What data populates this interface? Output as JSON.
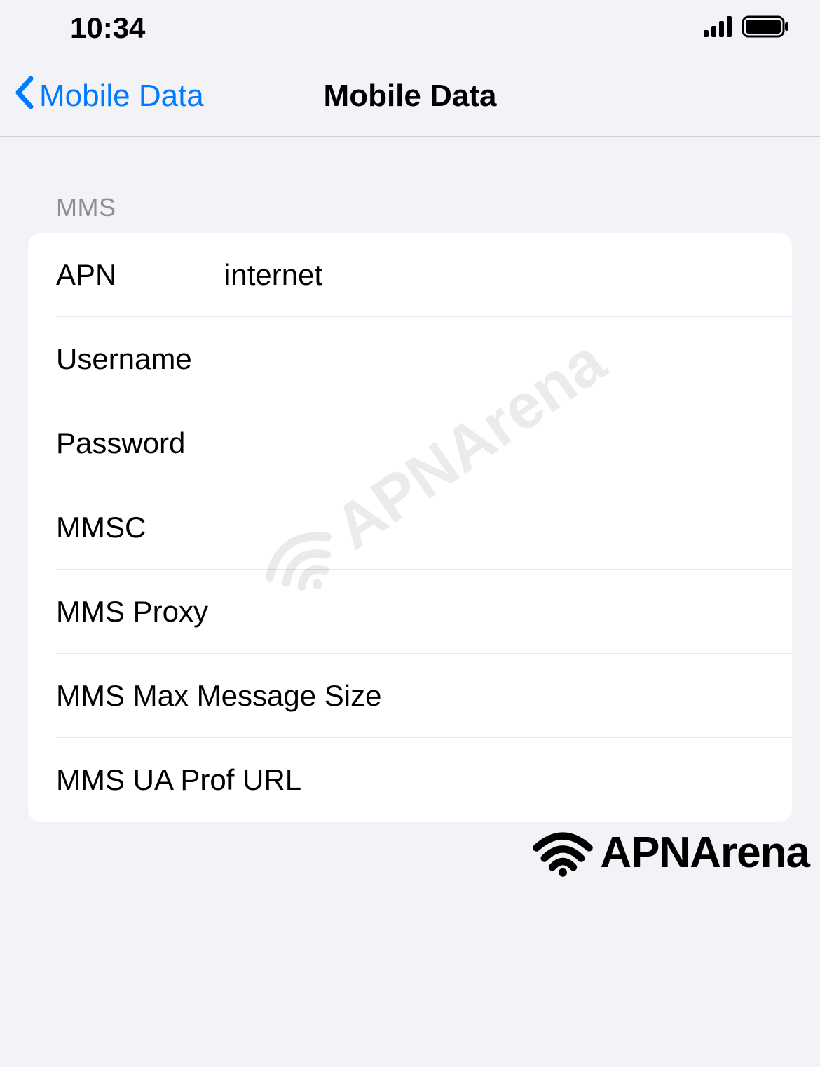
{
  "statusBar": {
    "time": "10:34"
  },
  "navBar": {
    "backLabel": "Mobile Data",
    "title": "Mobile Data"
  },
  "section": {
    "header": "MMS",
    "rows": {
      "apn": {
        "label": "APN",
        "value": "internet"
      },
      "username": {
        "label": "Username",
        "value": ""
      },
      "password": {
        "label": "Password",
        "value": ""
      },
      "mmsc": {
        "label": "MMSC",
        "value": ""
      },
      "mmsProxy": {
        "label": "MMS Proxy",
        "value": ""
      },
      "mmsMaxSize": {
        "label": "MMS Max Message Size",
        "value": ""
      },
      "mmsUaProf": {
        "label": "MMS UA Prof URL",
        "value": ""
      }
    }
  },
  "watermark": {
    "text": "APNArena"
  }
}
